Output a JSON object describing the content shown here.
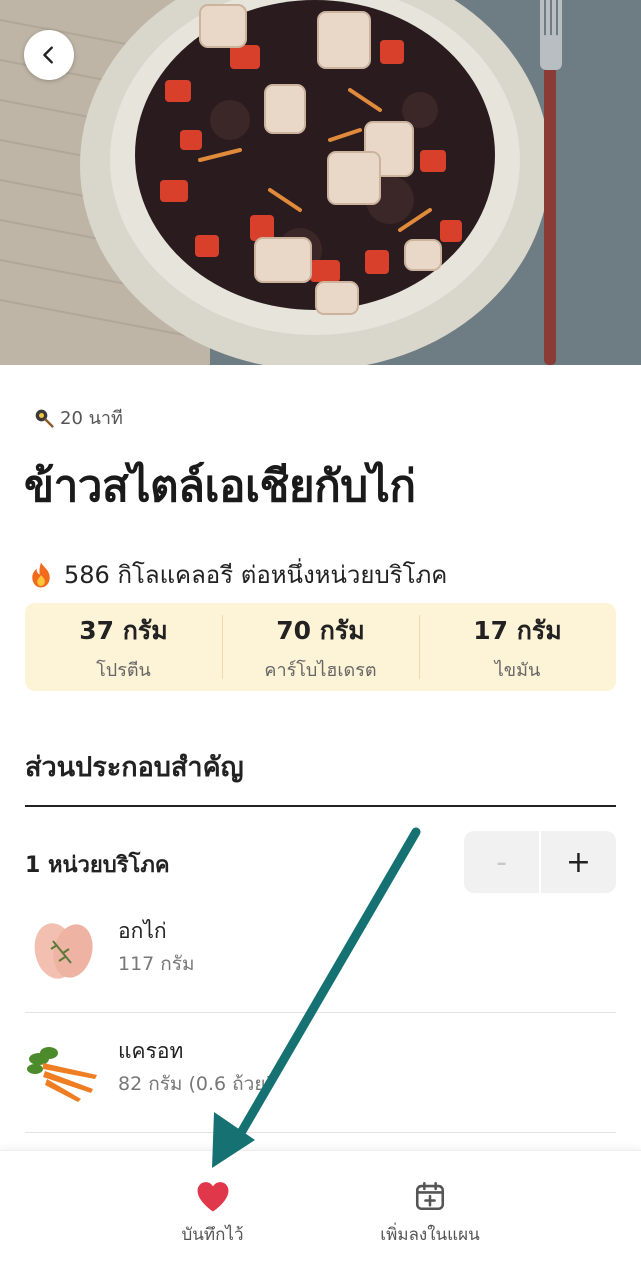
{
  "header": {
    "back_icon": "chevron-left-icon"
  },
  "recipe": {
    "time_icon": "pan-icon",
    "time": "20 นาที",
    "title": "ข้าวสไตล์เอเชียกับไก่",
    "calorie_icon": "fire-icon",
    "calories": "586 กิโลแคลอรี ต่อหนึ่งหน่วยบริโภค",
    "macros": [
      {
        "value": "37 กรัม",
        "label": "โปรตีน"
      },
      {
        "value": "70 กรัม",
        "label": "คาร์โบไฮเดรต"
      },
      {
        "value": "17 กรัม",
        "label": "ไขมัน"
      }
    ]
  },
  "ingredients_section": {
    "title": "ส่วนประกอบสำคัญ",
    "servings": "1 หน่วยบริโภค",
    "stepper": {
      "minus": "-",
      "plus": "+"
    },
    "items": [
      {
        "name": "อกไก่",
        "amount": "117 กรัม",
        "image": "chicken-breast-image"
      },
      {
        "name": "แครอท",
        "amount": "82 กรัม (0.6 ถ้วย)",
        "image": "carrot-image"
      }
    ]
  },
  "bottom_bar": {
    "save": {
      "label": "บันทึกไว้",
      "icon": "heart-icon"
    },
    "plan": {
      "label": "เพิ่มลงในแผน",
      "icon": "calendar-plus-icon"
    }
  },
  "colors": {
    "macro_bg": "#fdf3d6",
    "heart": "#e0374a",
    "arrow": "#167272"
  }
}
